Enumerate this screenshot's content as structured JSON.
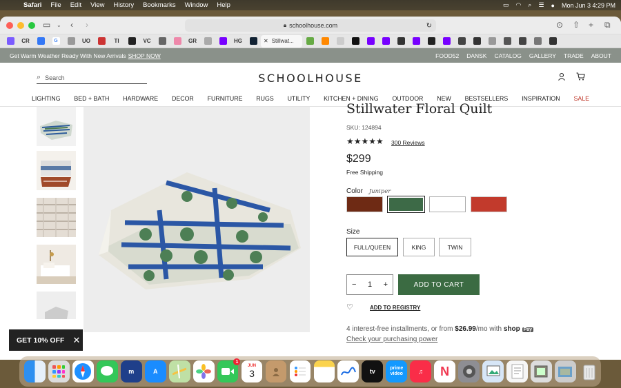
{
  "menubar": {
    "app": "Safari",
    "items": [
      "File",
      "Edit",
      "View",
      "History",
      "Bookmarks",
      "Window",
      "Help"
    ],
    "datetime": "Mon Jun 3  4:29 PM"
  },
  "browser": {
    "url": "schoolhouse.com",
    "active_tab": "Stillwat...",
    "favicon_labels": [
      "CR",
      "UO",
      "TI",
      "VC",
      "GR",
      "HG"
    ]
  },
  "promo": {
    "text": "Get Warm Weather Ready With New Arrivals",
    "link": "SHOP NOW",
    "links": [
      "FOOD52",
      "DANSK",
      "CATALOG",
      "GALLERY",
      "TRADE",
      "ABOUT"
    ]
  },
  "header": {
    "search_placeholder": "Search",
    "logo": "SCHOOLHOUSE"
  },
  "nav": [
    "LIGHTING",
    "BED + BATH",
    "HARDWARE",
    "DECOR",
    "FURNITURE",
    "RUGS",
    "UTILITY",
    "KITCHEN + DINING",
    "OUTDOOR",
    "NEW",
    "BESTSELLERS",
    "INSPIRATION",
    "SALE"
  ],
  "product": {
    "title": "Stillwater Floral Quilt",
    "sku": "SKU: 124894",
    "rating": 5,
    "stars": "★★★★★",
    "reviews": "300 Reviews",
    "price": "$299",
    "shipping": "Free Shipping",
    "color_label": "Color",
    "color_value": "Juniper",
    "swatches": [
      "#6e2a14",
      "#3d6a47",
      "#ffffff",
      "#c23a2c"
    ],
    "size_label": "Size",
    "sizes": [
      "FULL/QUEEN",
      "KING",
      "TWIN"
    ],
    "quantity": "1",
    "add_to_cart": "ADD TO CART",
    "registry": "ADD TO REGISTRY",
    "installments_pre": "4 interest-free installments, or from",
    "installments_amount": "$26.99",
    "installments_post": "/mo with",
    "shop": "shop",
    "pay": "Pay",
    "check_link": "Check your purchasing power"
  },
  "offer": {
    "text": "GET 10% OFF"
  },
  "dock": {
    "calendar_month": "JUN",
    "calendar_day": "3",
    "messages_badge": "1",
    "apps": [
      "finder",
      "launchpad",
      "safari",
      "messages",
      "microsoft-teams",
      "app-store",
      "maps",
      "photos",
      "facetime",
      "calendar",
      "contacts",
      "reminders",
      "notes",
      "freeform",
      "apple-tv",
      "prime-video",
      "music",
      "news",
      "system-settings",
      "preview",
      "textedit",
      "photo-browser",
      "downloads",
      "trash"
    ]
  }
}
